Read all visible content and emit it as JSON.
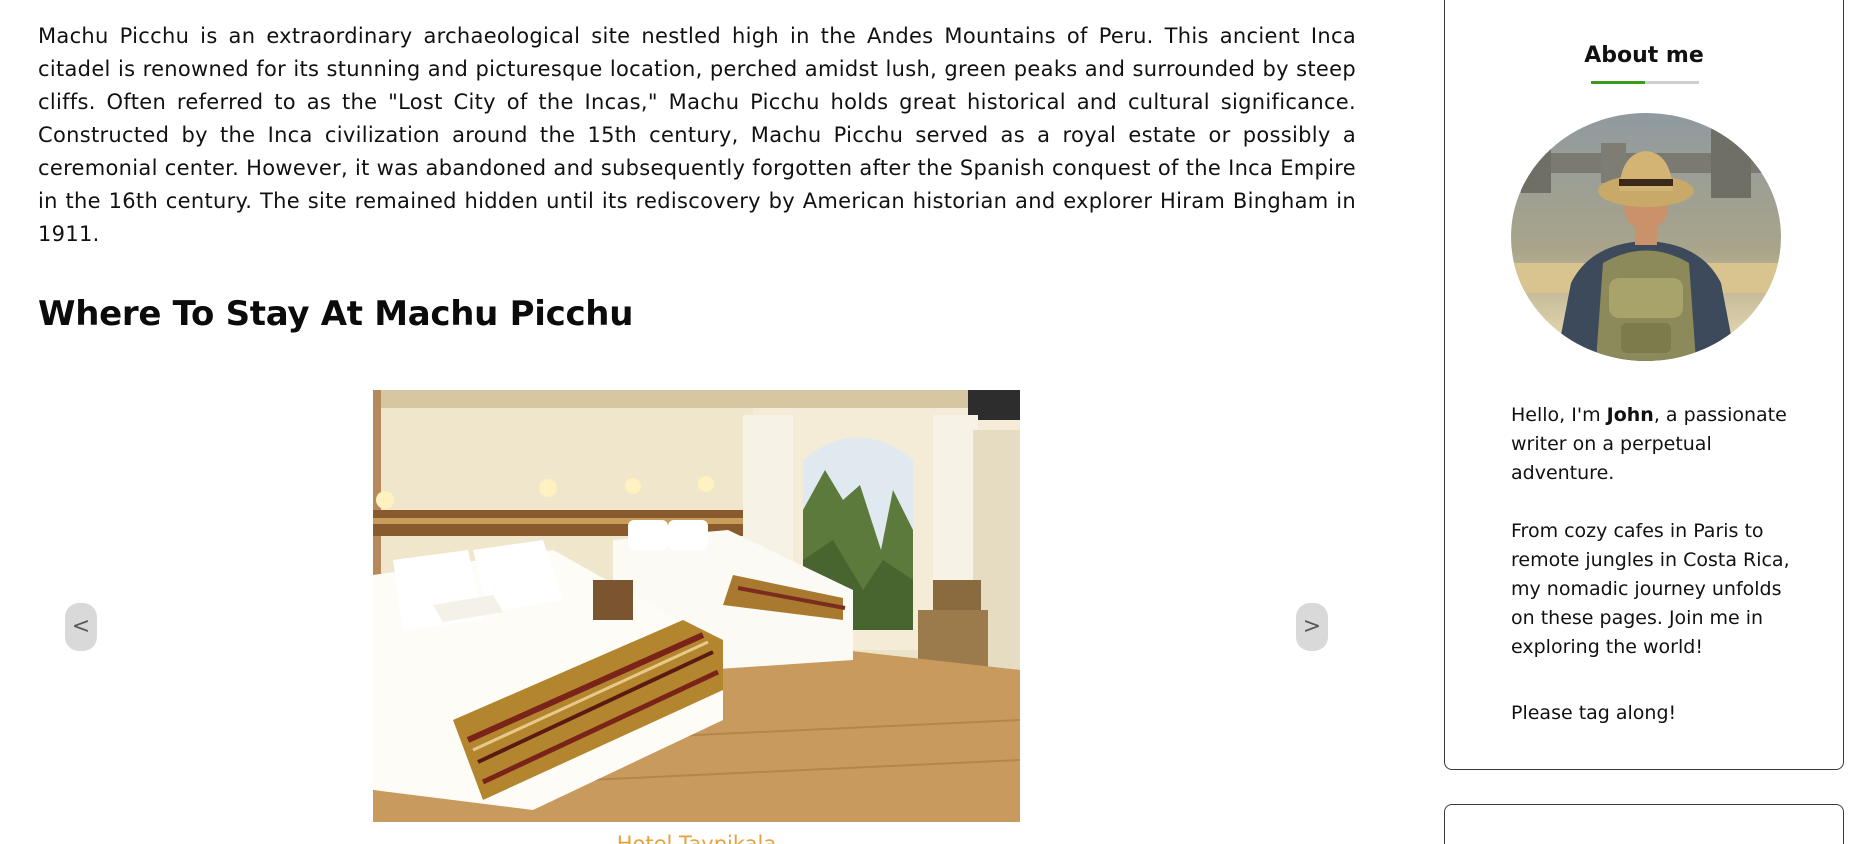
{
  "main": {
    "intro_text": "Machu Picchu is an extraordinary archaeological site nestled high in the Andes Mountains of Peru. This ancient Inca citadel is renowned for its stunning and picturesque location, perched amidst lush, green peaks and surrounded by steep cliffs. Often referred to as the \"Lost City of the Incas,\" Machu Picchu holds great historical and cultural significance. Constructed by the Inca civilization around the 15th century, Machu Picchu served as a royal estate or possibly a ceremonial center. However, it was abandoned and subsequently forgotten after the Spanish conquest of the Inca Empire in the 16th century. The site remained hidden until its rediscovery by American historian and explorer Hiram Bingham in 1911.",
    "section_title": "Where To Stay At Machu Picchu",
    "carousel": {
      "prev_label": "<",
      "next_label": ">",
      "slide_caption": "Hotel Taypikala"
    }
  },
  "sidebar": {
    "about": {
      "title": "About me",
      "greeting_prefix": "Hello, I'm ",
      "name": "John",
      "greeting_suffix": ", a passionate writer on a perpetual adventure.",
      "paragraph2": "From cozy cafes in Paris to remote jungles in Costa Rica, my nomadic journey unfolds on these pages. Join me in exploring the world!",
      "paragraph3": "Please tag along!"
    }
  },
  "colors": {
    "accent_green": "#3e9a1b",
    "caption_orange": "#e8a23c",
    "carousel_button_bg": "#d9d9d9"
  }
}
